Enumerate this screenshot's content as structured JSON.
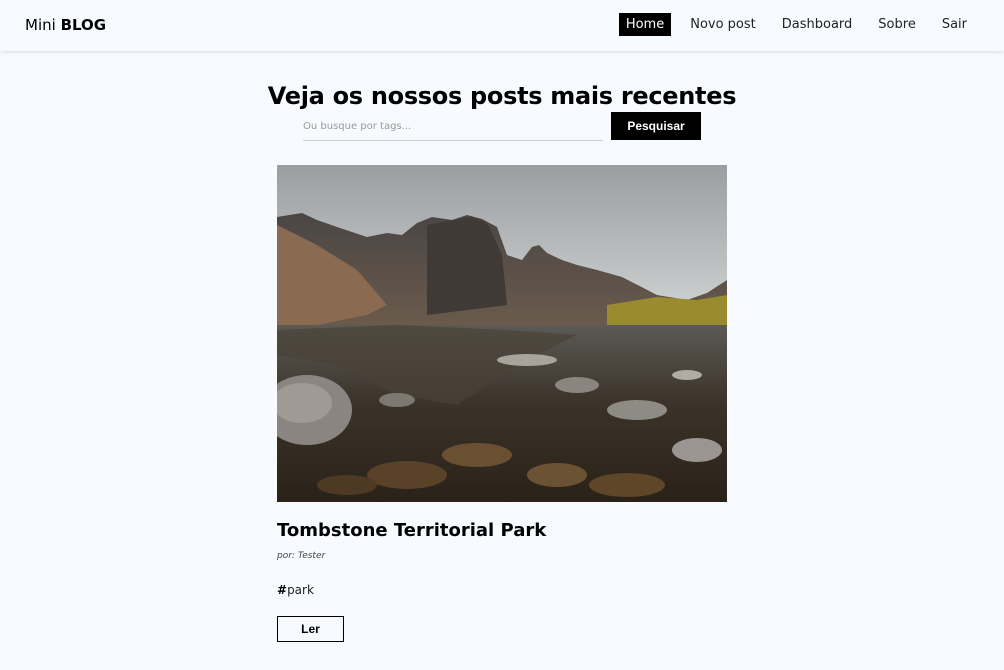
{
  "navbar": {
    "brand_prefix": "Mini",
    "brand_bold": "BLOG",
    "links": [
      {
        "label": "Home",
        "active": true
      },
      {
        "label": "Novo post",
        "active": false
      },
      {
        "label": "Dashboard",
        "active": false
      },
      {
        "label": "Sobre",
        "active": false
      },
      {
        "label": "Sair",
        "active": false
      }
    ]
  },
  "main": {
    "title": "Veja os nossos posts mais recentes",
    "search": {
      "placeholder": "Ou busque por tags...",
      "value": "",
      "button_label": "Pesquisar"
    },
    "posts": [
      {
        "title": "Tombstone Territorial Park",
        "author": "por: Tester",
        "tags": [
          {
            "hash": "#",
            "name": "park"
          }
        ],
        "read_label": "Ler"
      }
    ]
  },
  "colors": {
    "background": "#f7fbff",
    "accent": "#000000",
    "accent_text": "#ffffff"
  }
}
